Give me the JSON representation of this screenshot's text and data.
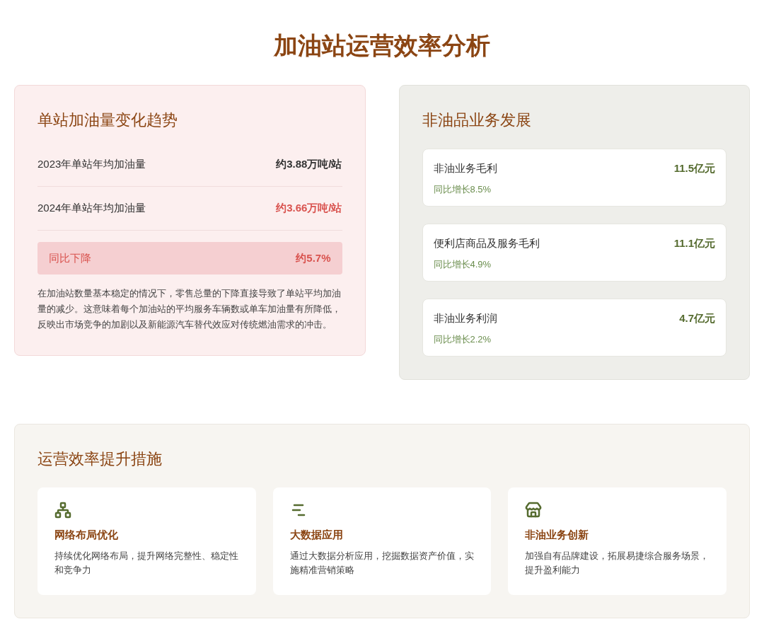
{
  "title": "加油站运营效率分析",
  "volume_card": {
    "heading": "单站加油量变化趋势",
    "rows": [
      {
        "label": "2023年单站年均加油量",
        "value": "约3.88万吨/站",
        "negative": false
      },
      {
        "label": "2024年单站年均加油量",
        "value": "约3.66万吨/站",
        "negative": true
      }
    ],
    "change": {
      "label": "同比下降",
      "value": "约5.7%"
    },
    "note": "在加油站数量基本稳定的情况下，零售总量的下降直接导致了单站平均加油量的减少。这意味着每个加油站的平均服务车辆数或单车加油量有所降低，反映出市场竞争的加剧以及新能源汽车替代效应对传统燃油需求的冲击。"
  },
  "nonfuel_card": {
    "heading": "非油品业务发展",
    "items": [
      {
        "label": "非油业务毛利",
        "value": "11.5亿元",
        "growth": "同比增长8.5%"
      },
      {
        "label": "便利店商品及服务毛利",
        "value": "11.1亿元",
        "growth": "同比增长4.9%"
      },
      {
        "label": "非油业务利润",
        "value": "4.7亿元",
        "growth": "同比增长2.2%"
      }
    ]
  },
  "measures": {
    "heading": "运营效率提升措施",
    "items": [
      {
        "title": "网络布局优化",
        "text": "持续优化网络布局，提升网络完整性、稳定性和竞争力"
      },
      {
        "title": "大数据应用",
        "text": "通过大数据分析应用，挖掘数据资产价值，实施精准营销策略"
      },
      {
        "title": "非油业务创新",
        "text": "加强自有品牌建设，拓展易捷综合服务场景，提升盈利能力"
      }
    ]
  }
}
